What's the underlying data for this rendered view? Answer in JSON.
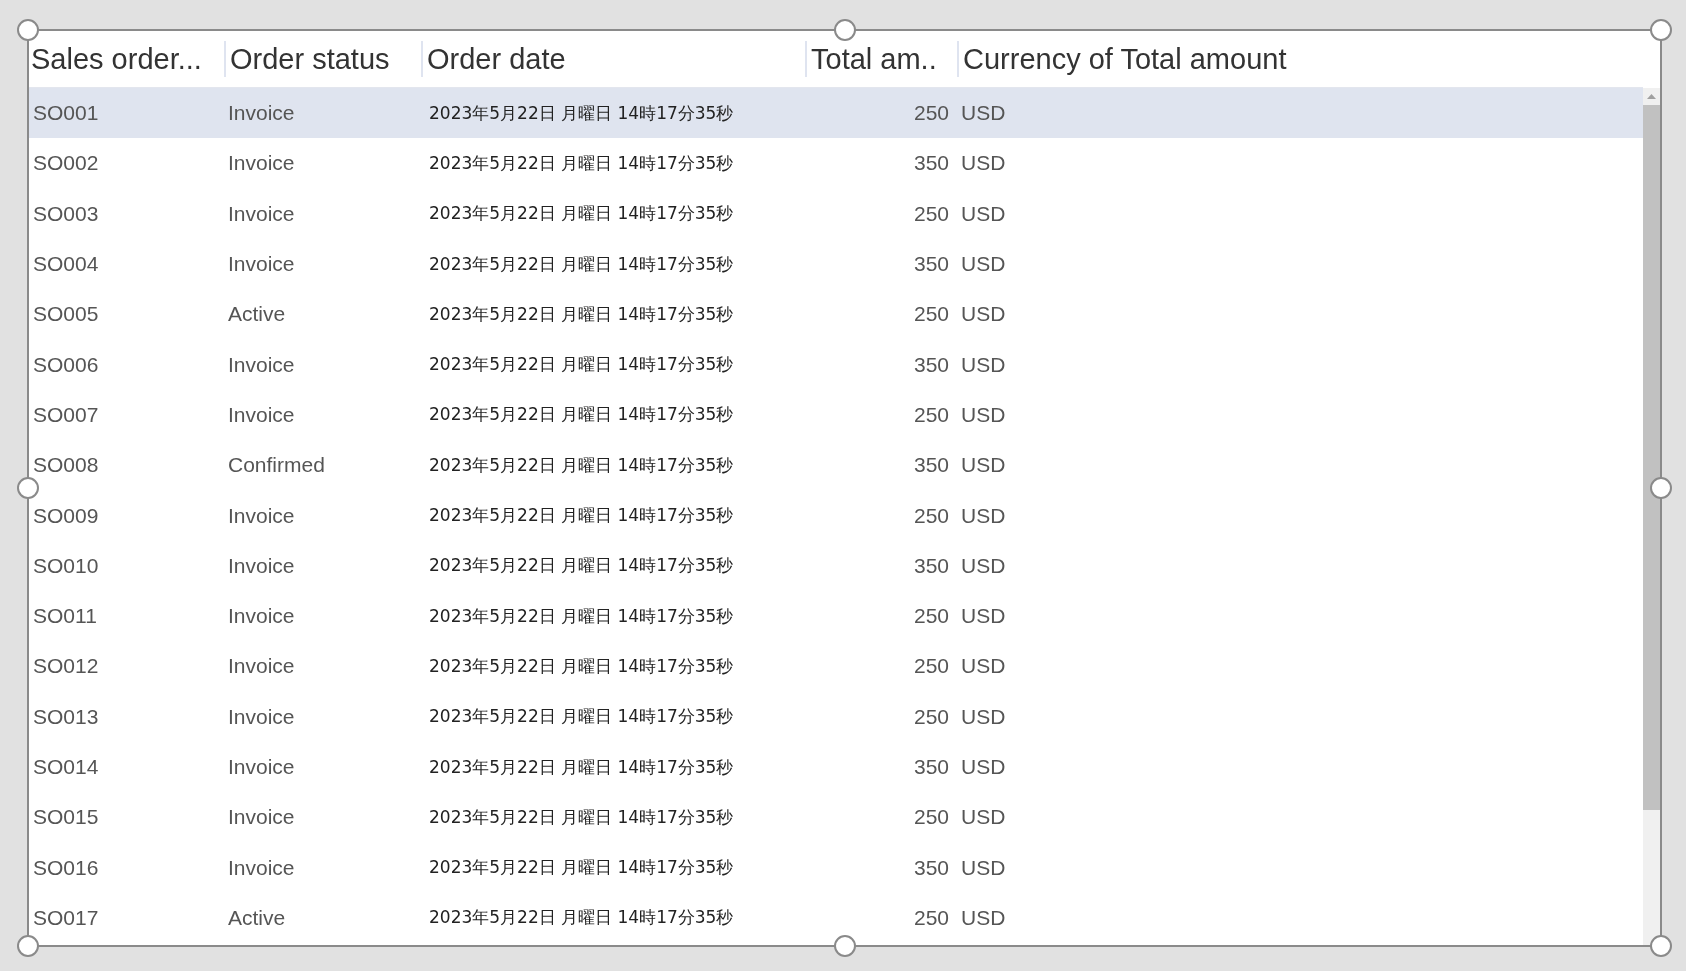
{
  "table": {
    "columns": [
      "Sales order...",
      "Order status",
      "Order date",
      "Total am..",
      "Currency of Total amount"
    ],
    "rows": [
      {
        "cells": [
          "SO001",
          "Invoice",
          "2023年5月22日 月曜日 14時17分35秒",
          "250",
          "USD"
        ],
        "selected": true
      },
      {
        "cells": [
          "SO002",
          "Invoice",
          "2023年5月22日 月曜日 14時17分35秒",
          "350",
          "USD"
        ],
        "selected": false
      },
      {
        "cells": [
          "SO003",
          "Invoice",
          "2023年5月22日 月曜日 14時17分35秒",
          "250",
          "USD"
        ],
        "selected": false
      },
      {
        "cells": [
          "SO004",
          "Invoice",
          "2023年5月22日 月曜日 14時17分35秒",
          "350",
          "USD"
        ],
        "selected": false
      },
      {
        "cells": [
          "SO005",
          "Active",
          "2023年5月22日 月曜日 14時17分35秒",
          "250",
          "USD"
        ],
        "selected": false
      },
      {
        "cells": [
          "SO006",
          "Invoice",
          "2023年5月22日 月曜日 14時17分35秒",
          "350",
          "USD"
        ],
        "selected": false
      },
      {
        "cells": [
          "SO007",
          "Invoice",
          "2023年5月22日 月曜日 14時17分35秒",
          "250",
          "USD"
        ],
        "selected": false
      },
      {
        "cells": [
          "SO008",
          "Confirmed",
          "2023年5月22日 月曜日 14時17分35秒",
          "350",
          "USD"
        ],
        "selected": false
      },
      {
        "cells": [
          "SO009",
          "Invoice",
          "2023年5月22日 月曜日 14時17分35秒",
          "250",
          "USD"
        ],
        "selected": false
      },
      {
        "cells": [
          "SO010",
          "Invoice",
          "2023年5月22日 月曜日 14時17分35秒",
          "350",
          "USD"
        ],
        "selected": false
      },
      {
        "cells": [
          "SO011",
          "Invoice",
          "2023年5月22日 月曜日 14時17分35秒",
          "250",
          "USD"
        ],
        "selected": false
      },
      {
        "cells": [
          "SO012",
          "Invoice",
          "2023年5月22日 月曜日 14時17分35秒",
          "250",
          "USD"
        ],
        "selected": false
      },
      {
        "cells": [
          "SO013",
          "Invoice",
          "2023年5月22日 月曜日 14時17分35秒",
          "250",
          "USD"
        ],
        "selected": false
      },
      {
        "cells": [
          "SO014",
          "Invoice",
          "2023年5月22日 月曜日 14時17分35秒",
          "350",
          "USD"
        ],
        "selected": false
      },
      {
        "cells": [
          "SO015",
          "Invoice",
          "2023年5月22日 月曜日 14時17分35秒",
          "250",
          "USD"
        ],
        "selected": false
      },
      {
        "cells": [
          "SO016",
          "Invoice",
          "2023年5月22日 月曜日 14時17分35秒",
          "350",
          "USD"
        ],
        "selected": false
      },
      {
        "cells": [
          "SO017",
          "Active",
          "2023年5月22日 月曜日 14時17分35秒",
          "250",
          "USD"
        ],
        "selected": false
      }
    ]
  }
}
